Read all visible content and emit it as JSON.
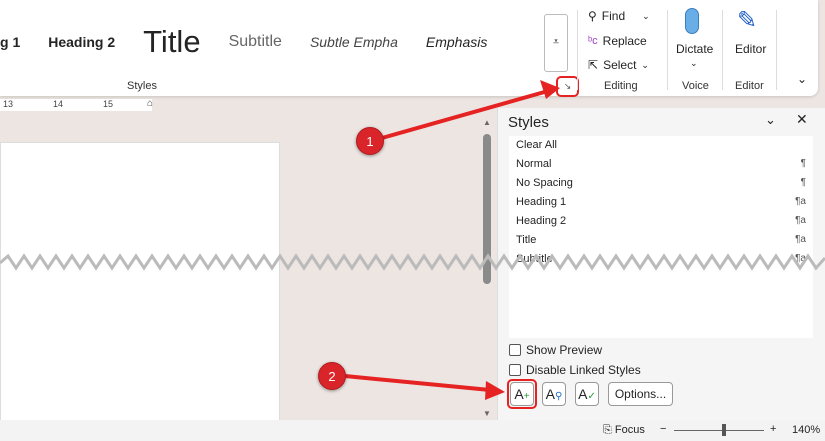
{
  "styles_gallery": [
    "g 1",
    "Heading 2",
    "Title",
    "Subtitle",
    "Subtle Empha",
    "Emphasis"
  ],
  "groups": {
    "styles": "Styles",
    "editing": "Editing",
    "voice": "Voice",
    "editor": "Editor"
  },
  "editing": {
    "find": "Find",
    "replace": "Replace",
    "select": "Select"
  },
  "voice": {
    "dictate": "Dictate"
  },
  "editor": {
    "label": "Editor"
  },
  "ruler": [
    "13",
    "14",
    "15"
  ],
  "pane": {
    "title": "Styles",
    "items": [
      {
        "name": "Clear All",
        "mark": ""
      },
      {
        "name": "Normal",
        "mark": "¶"
      },
      {
        "name": "No Spacing",
        "mark": "¶"
      },
      {
        "name": "Heading 1",
        "mark": "¶a"
      },
      {
        "name": "Heading 2",
        "mark": "¶a"
      },
      {
        "name": "Title",
        "mark": "¶a"
      },
      {
        "name": "Subtitle",
        "mark": "¶a"
      }
    ],
    "show_preview": "Show Preview",
    "disable_linked": "Disable Linked Styles",
    "options": "Options..."
  },
  "status": {
    "focus": "Focus",
    "zoom": "140%"
  },
  "annotations": [
    "1",
    "2"
  ],
  "colors": {
    "accent": "#e52323"
  }
}
